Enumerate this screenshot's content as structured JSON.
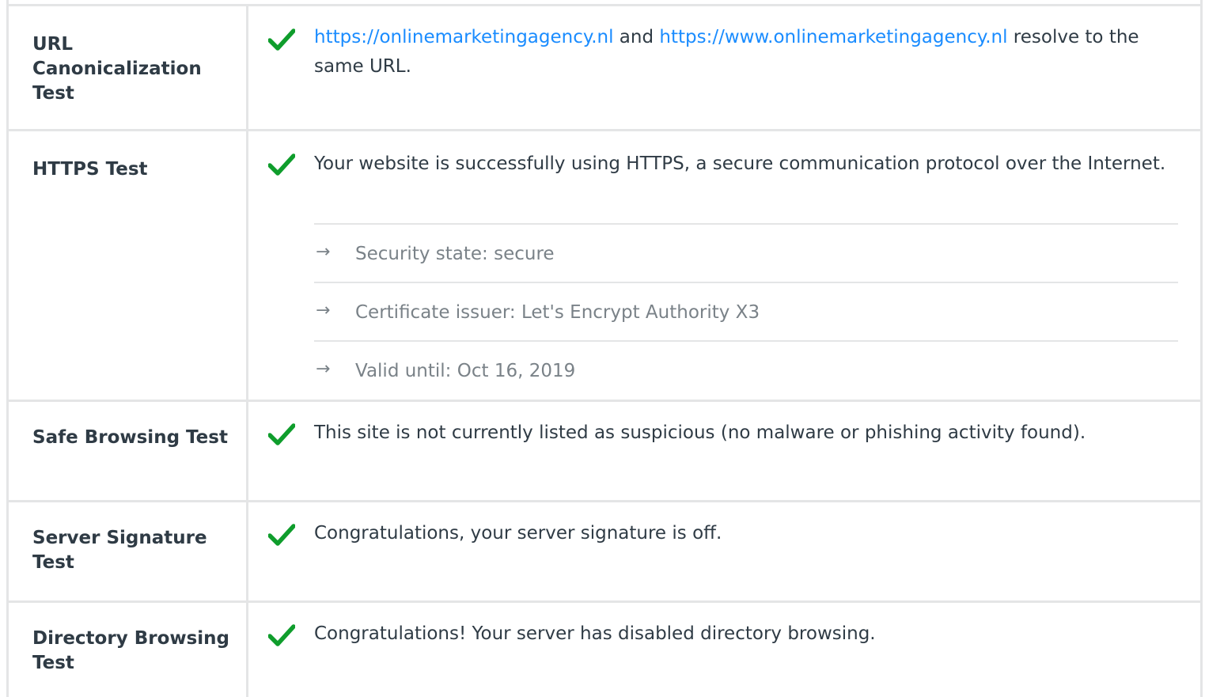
{
  "rows": [
    {
      "label": "URL Canonicalization Test",
      "status": "pass",
      "message": {
        "link1": "https://onlinemarketingagency.nl",
        "mid": " and ",
        "link2": "https://www.onlinemarketingagency.nl",
        "tail": " resolve to the same URL."
      }
    },
    {
      "label": "HTTPS Test",
      "status": "pass",
      "message": "Your website is successfully using HTTPS, a secure communication protocol over the Internet.",
      "details": [
        "Security state: secure",
        "Certificate issuer: Let's Encrypt Authority X3",
        "Valid until: Oct 16, 2019"
      ]
    },
    {
      "label": "Safe Browsing Test",
      "status": "pass",
      "message": "This site is not currently listed as suspicious (no malware or phishing activity found)."
    },
    {
      "label": "Server Signature Test",
      "status": "pass",
      "message": "Congratulations, your server signature is off."
    },
    {
      "label": "Directory Browsing Test",
      "status": "pass",
      "message": "Congratulations! Your server has disabled directory browsing."
    }
  ],
  "colors": {
    "pass": "#0f9d2c",
    "link": "#1a8cff",
    "border": "#e4e5e6",
    "text": "#2f3b45",
    "muted": "#7a8288"
  },
  "icons": {
    "pass": "checkmark-icon",
    "detail": "arrow-right-icon"
  }
}
